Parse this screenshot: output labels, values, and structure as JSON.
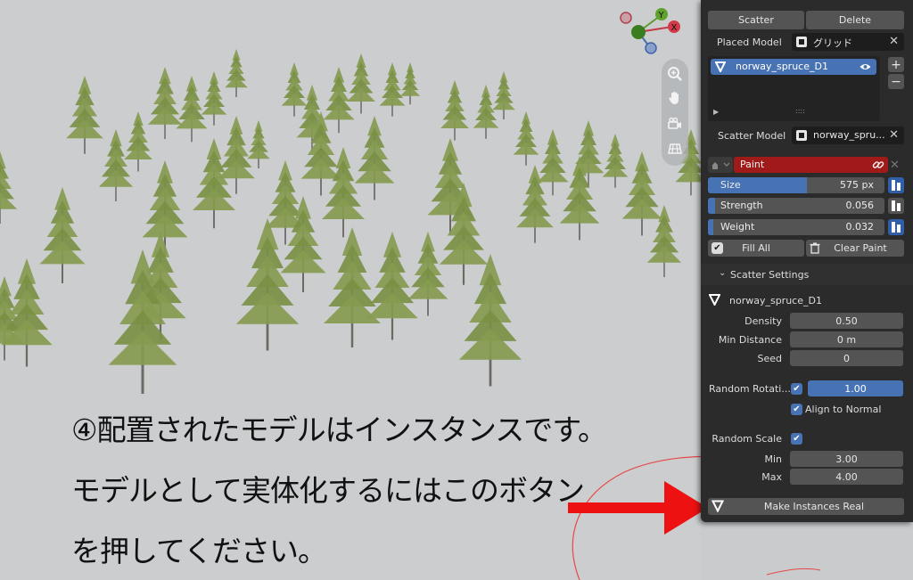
{
  "overlay": {
    "line1": "④配置されたモデルはインスタンスです。",
    "line2": "モデルとして実体化するにはこのボタン",
    "line3": "を押してください。"
  },
  "gizmo": {
    "x_label": "X",
    "y_label": "Y"
  },
  "panel": {
    "scatter_label": "Scatter",
    "delete_label": "Delete",
    "placed_model_label": "Placed  Model",
    "placed_model_value": "グリッド",
    "list_item": "norway_spruce_D1",
    "list_grip": "::::",
    "scatter_model_label": "Scatter Model",
    "scatter_model_value": "norway_spru...",
    "paint_label": "Paint",
    "sliders": [
      {
        "name": "Size",
        "value": "575 px",
        "fill": 0.45
      },
      {
        "name": "Strength",
        "value": "0.056",
        "fill": 0.04
      },
      {
        "name": "Weight",
        "value": "0.032",
        "fill": 0.03
      }
    ],
    "fill_all_label": "Fill All",
    "clear_paint_label": "Clear Paint",
    "scatter_settings_label": "Scatter Settings",
    "model_name": "norway_spruce_D1",
    "density_label": "Density",
    "density_value": "0.50",
    "min_distance_label": "Min Distance",
    "min_distance_value": "0 m",
    "seed_label": "Seed",
    "seed_value": "0",
    "random_rotation_label": "Random Rotati...",
    "random_rotation_value": "1.00",
    "align_normal_label": "Align to Normal",
    "random_scale_label": "Random Scale",
    "min_label": "Min",
    "min_value": "3.00",
    "max_label": "Max",
    "max_value": "4.00",
    "make_real_label": "Make Instances Real"
  },
  "colors": {
    "accent_blue": "#4772b3",
    "paint_red": "#a11a1a",
    "arrow_red": "#ee1111",
    "tree_green": "#7f9448"
  }
}
